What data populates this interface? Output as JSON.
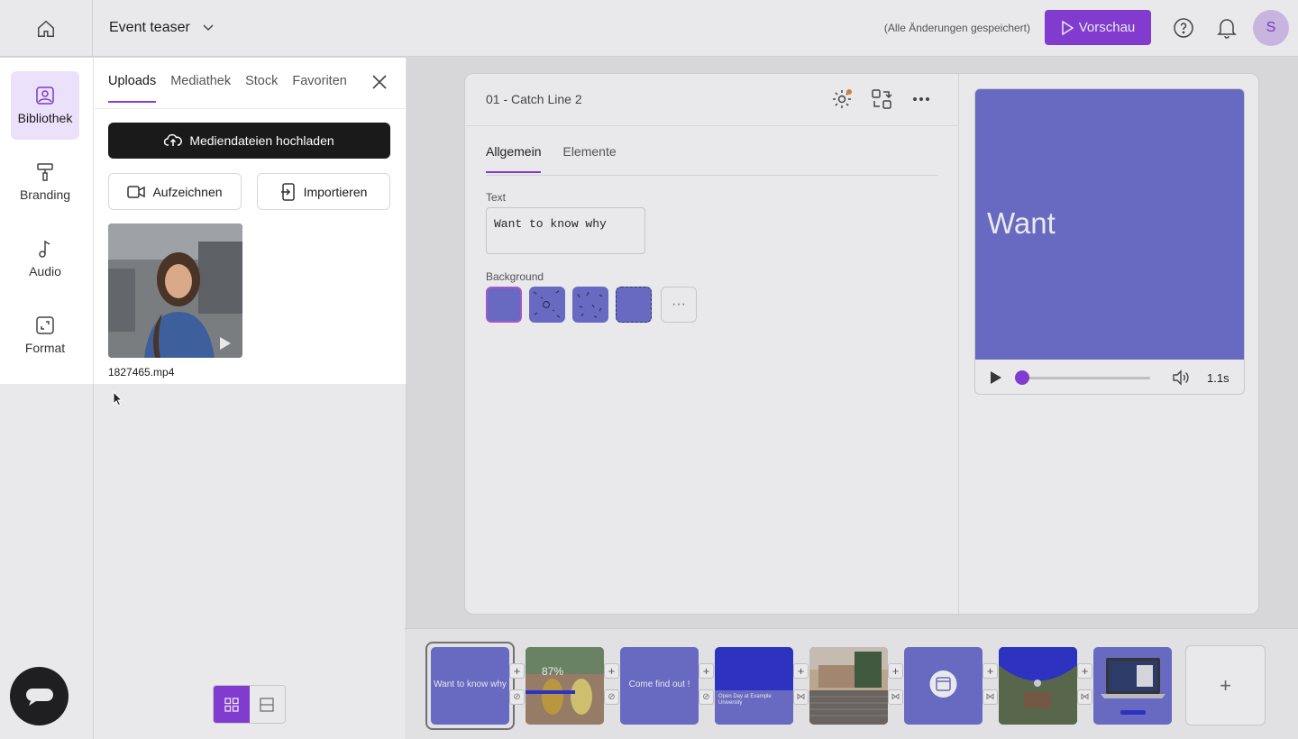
{
  "header": {
    "project_title": "Event teaser",
    "saved_status": "(Alle Änderungen gespeichert)",
    "preview_label": "Vorschau",
    "avatar_initial": "S"
  },
  "rail": {
    "items": [
      {
        "label": "Bibliothek",
        "icon": "image-icon"
      },
      {
        "label": "Branding",
        "icon": "paint-roller-icon"
      },
      {
        "label": "Audio",
        "icon": "music-note-icon"
      },
      {
        "label": "Format",
        "icon": "resize-icon"
      }
    ]
  },
  "library": {
    "tabs": [
      "Uploads",
      "Mediathek",
      "Stock",
      "Favoriten"
    ],
    "upload_label": "Mediendateien hochladen",
    "record_label": "Aufzeichnen",
    "import_label": "Importieren",
    "file_name": "1827465.mp4"
  },
  "editor": {
    "scene_name": "01 - Catch Line 2",
    "tabs": [
      "Allgemein",
      "Elemente"
    ],
    "text_label": "Text",
    "text_value": "Want to know why",
    "background_label": "Background",
    "more_label": "···"
  },
  "preview": {
    "word": "Want",
    "time": "1.1s",
    "progress": 0.0
  },
  "timeline": {
    "scenes": [
      {
        "text": "Want to know why",
        "color": "#6b6fcf"
      },
      {
        "text": "87%",
        "color": "#9a7d6a"
      },
      {
        "text": "Come find out !",
        "color": "#6b6fcf"
      },
      {
        "text": "Open Day at Example University",
        "color": "#2a2fcf"
      },
      {
        "text": "",
        "color": "#8b7a64"
      },
      {
        "text": "",
        "color": "#6b6fcf"
      },
      {
        "text": "",
        "color": "#2a2fcf"
      },
      {
        "text": "",
        "color": "#6b6fcf"
      }
    ],
    "add_label": "+"
  },
  "colors": {
    "accent": "#8a3ae0",
    "scene_blue": "#6b6fcf"
  }
}
